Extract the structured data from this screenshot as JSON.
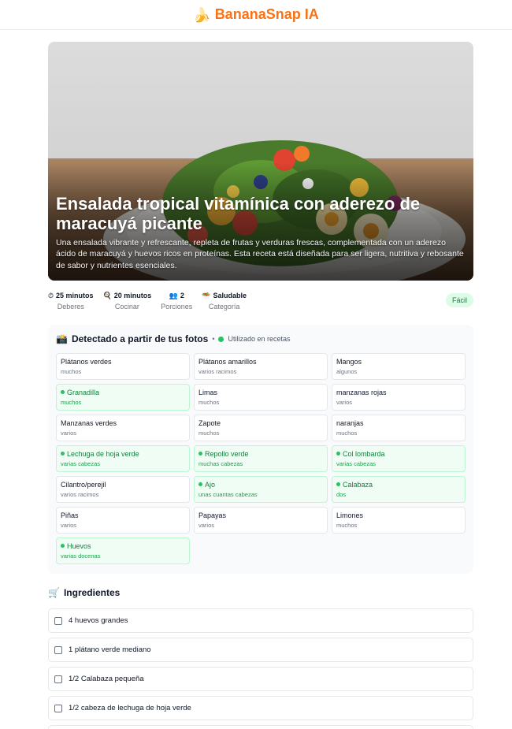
{
  "header": {
    "logo_icon": "🍌",
    "brand": "BananaSnap IA"
  },
  "recipe": {
    "title": "Ensalada tropical vitamínica con aderezo de maracuyá picante",
    "description": "Una ensalada vibrante y refrescante, repleta de frutas y verduras frescas, complementada con un aderezo ácido de maracuyá y huevos ricos en proteínas. Esta receta está diseñada para ser ligera, nutritiva y rebosante de sabor y nutrientes esenciales."
  },
  "meta": {
    "prep": {
      "icon": "⏱",
      "value": "25 minutos",
      "label": "Deberes"
    },
    "cook": {
      "icon": "🍳",
      "value": "20 minutos",
      "label": "Cocinar"
    },
    "servings": {
      "icon": "👥",
      "value": "2",
      "label": "Porciones"
    },
    "category": {
      "icon": "🥗",
      "value": "Saludable",
      "label": "Categoría"
    },
    "difficulty": "Fácil"
  },
  "detected": {
    "icon": "📸",
    "title": "Detectado a partir de tus fotos",
    "sep": "•",
    "legend": "Utilizado en recetas",
    "items": [
      {
        "name": "Plátanos verdes",
        "qty": "muchos",
        "used": false
      },
      {
        "name": "Plátanos amarillos",
        "qty": "varios racimos",
        "used": false
      },
      {
        "name": "Mangos",
        "qty": "algunos",
        "used": false
      },
      {
        "name": "Granadilla",
        "qty": "muchos",
        "used": true
      },
      {
        "name": "Limas",
        "qty": "muchos",
        "used": false
      },
      {
        "name": "manzanas rojas",
        "qty": "varios",
        "used": false
      },
      {
        "name": "Manzanas verdes",
        "qty": "varios",
        "used": false
      },
      {
        "name": "Zapote",
        "qty": "muchos",
        "used": false
      },
      {
        "name": "naranjas",
        "qty": "muchos",
        "used": false
      },
      {
        "name": "Lechuga de hoja verde",
        "qty": "varias cabezas",
        "used": true
      },
      {
        "name": "Repollo verde",
        "qty": "muchas cabezas",
        "used": true
      },
      {
        "name": "Col lombarda",
        "qty": "varias cabezas",
        "used": true
      },
      {
        "name": "Cilantro/perejil",
        "qty": "varios racimos",
        "used": false
      },
      {
        "name": "Ajo",
        "qty": "unas cuantas cabezas",
        "used": true
      },
      {
        "name": "Calabaza",
        "qty": "dos",
        "used": true
      },
      {
        "name": "Piñas",
        "qty": "varios",
        "used": false
      },
      {
        "name": "Papayas",
        "qty": "varios",
        "used": false
      },
      {
        "name": "Limones",
        "qty": "muchos",
        "used": false
      },
      {
        "name": "Huevos",
        "qty": "varias docenas",
        "used": true
      }
    ]
  },
  "ingredients": {
    "icon": "🛒",
    "title": "Ingredientes",
    "items": [
      "4 huevos grandes",
      "1 plátano verde mediano",
      "1/2 Calabaza pequeña",
      "1/2 cabeza de lechuga de hoja verde",
      ""
    ]
  }
}
